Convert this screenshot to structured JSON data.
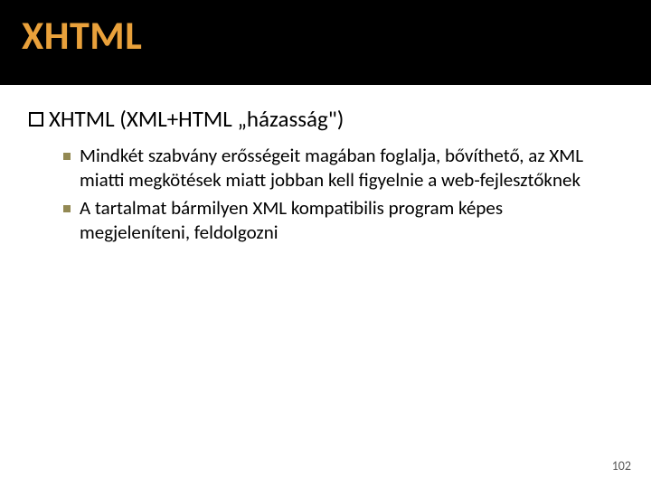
{
  "title": "XHTML",
  "level1_text": "XHTML (XML+HTML „házasság\")",
  "bullets": [
    "Mindkét szabvány erősségeit magában foglalja, bővíthető, az XML miatti megkötések miatt jobban kell figyelnie a web-fejlesztőknek",
    "A tartalmat bármilyen XML kompatibilis program képes megjeleníteni, feldolgozni"
  ],
  "page_number": "102"
}
